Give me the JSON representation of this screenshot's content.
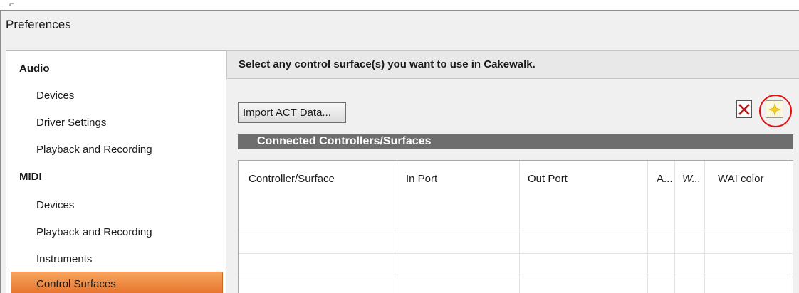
{
  "dialog": {
    "title": "Preferences"
  },
  "sidebar": {
    "items": [
      {
        "label": "Audio",
        "kind": "header"
      },
      {
        "label": "Devices",
        "kind": "sub"
      },
      {
        "label": "Driver Settings",
        "kind": "sub"
      },
      {
        "label": "Playback and Recording",
        "kind": "sub"
      },
      {
        "label": "MIDI",
        "kind": "header"
      },
      {
        "label": "Devices",
        "kind": "sub"
      },
      {
        "label": "Playback and Recording",
        "kind": "sub"
      },
      {
        "label": "Instruments",
        "kind": "sub"
      },
      {
        "label": "Control Surfaces",
        "kind": "selected"
      }
    ]
  },
  "main": {
    "header_text": "Select any control surface(s) you want to use in Cakewalk.",
    "import_button": "Import ACT Data...",
    "delete_icon": "delete-x-icon",
    "new_icon": "new-controller-icon",
    "section_title": "Connected Controllers/Surfaces",
    "columns": [
      "Controller/Surface",
      "In Port",
      "Out Port",
      "A...",
      "W...",
      "WAI color"
    ],
    "rows": []
  },
  "colors": {
    "selected_gradient_top": "#f6a45c",
    "selected_gradient_bottom": "#e6712a",
    "section_bar": "#6e6e6e",
    "highlight_ring": "#e01010"
  }
}
